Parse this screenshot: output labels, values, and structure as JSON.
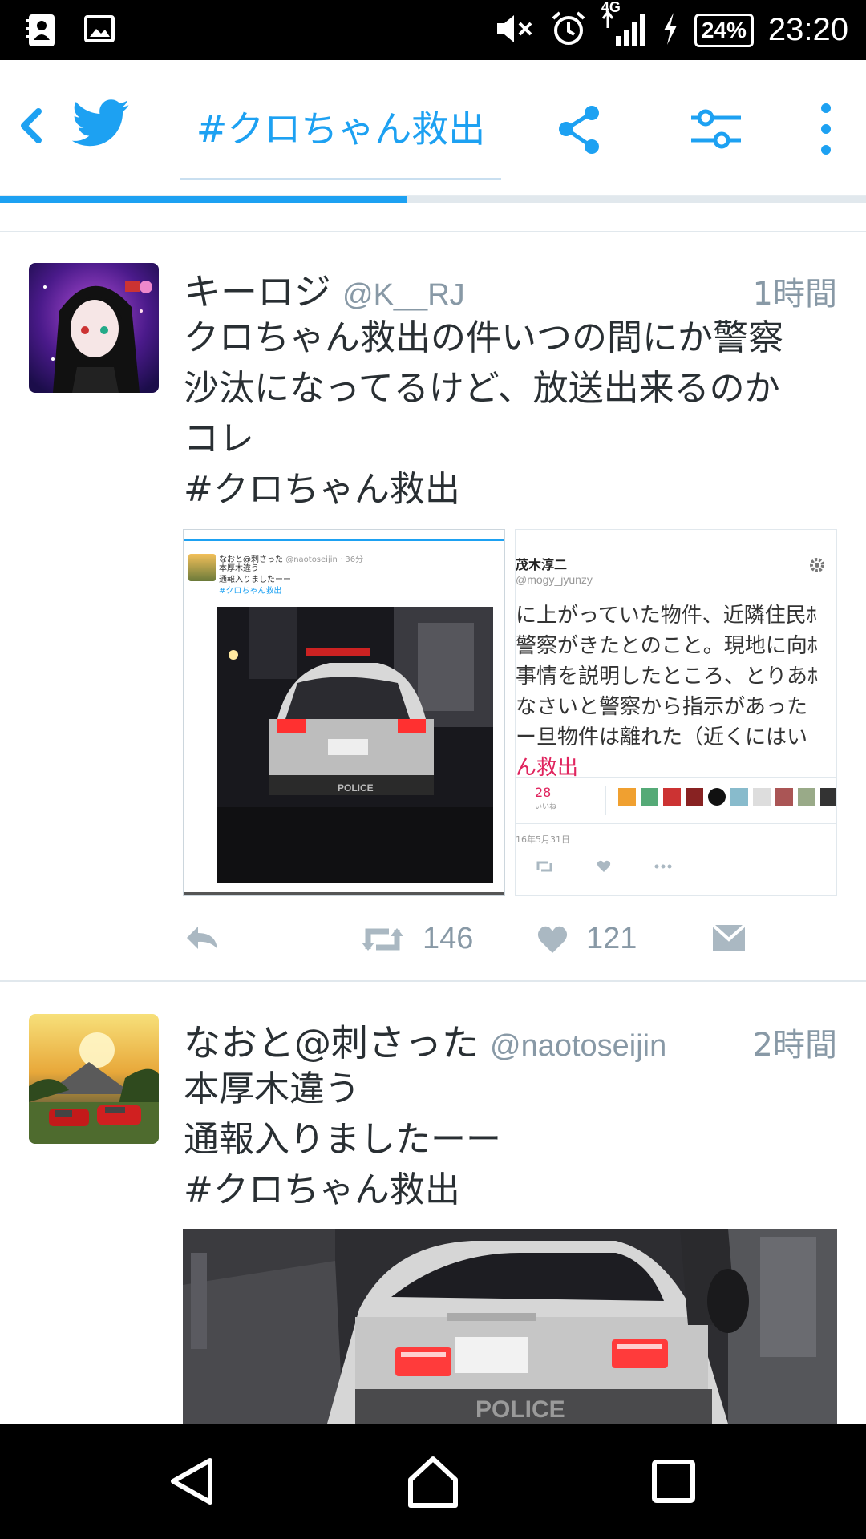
{
  "status_bar": {
    "time": "23:20",
    "battery": "24%",
    "network": "4G"
  },
  "app_bar": {
    "tab_title": "#クロちゃん救出",
    "icons": [
      "back-icon",
      "twitter-bird-icon",
      "share-icon",
      "filter-icon",
      "more-icon"
    ],
    "loading_progress": 0.47
  },
  "tweets": [
    {
      "name": "キーロジ",
      "handle": "@K__RJ",
      "time": "1時間",
      "lines": [
        "クロちゃん救出の件いつの間にか警察",
        "沙汰になってるけど、放送出来るのか",
        "コレ",
        "#クロちゃん救出"
      ],
      "media_left": {
        "user": "なおと@刺さった",
        "handle": "@naotoseijin · 36分",
        "text1": "本厚木違う",
        "text2": "通報入りましたーー",
        "tag": "#クロちゃん救出"
      },
      "media_right": {
        "name": "茂木淳二",
        "handle": "@mogy_jyunzy",
        "lines": [
          "に上がっていた物件、近隣住民ﾎ",
          "警察がきたとのこと。現地に向ﾎ",
          "事情を説明したところ、とりあﾎ",
          "なさいと警察から指示があった",
          "ー旦物件は離れた（近くにはい"
        ],
        "tag_line": "ん救出",
        "likes_count": "28",
        "likes_label": "いいね",
        "date": "16年5月31日"
      },
      "retweets": "146",
      "likes": "121"
    },
    {
      "name": "なおと@刺さった",
      "handle": "@naotoseijin",
      "time": "2時間",
      "lines": [
        "本厚木違う",
        "通報入りましたーー",
        "#クロちゃん救出"
      ],
      "plate_text": "POLICE"
    }
  ],
  "colors": {
    "accent": "#1da1f2",
    "text_primary": "#292f33",
    "text_secondary": "#8899a6",
    "divider": "#e1e8ed",
    "link_red": "#e0245e"
  }
}
